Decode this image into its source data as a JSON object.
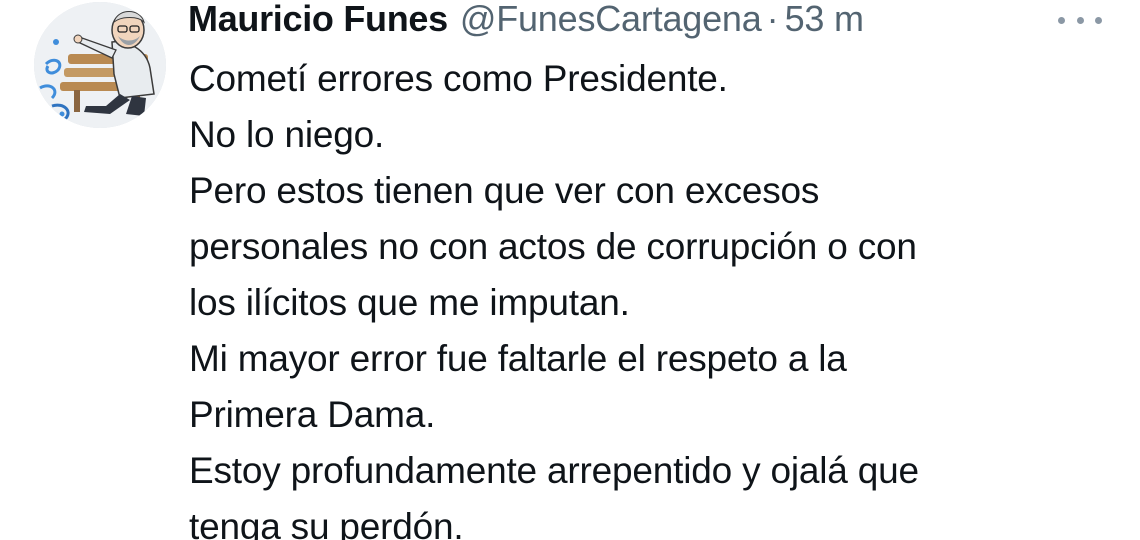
{
  "tweet": {
    "author_name": "Mauricio Funes",
    "author_handle": "@FunesCartagena",
    "separator": "·",
    "timestamp": "53 m",
    "avatar_icon": "cartoon-caricature-avatar",
    "more_icon": "more-horizontal-icon",
    "lines": [
      "Cometí errores como Presidente.",
      "No lo niego.",
      "Pero estos tienen que ver con excesos",
      "personales no con actos de corrupción o con",
      "los ilícitos que me imputan.",
      "Mi mayor error fue faltarle el respeto a la",
      "Primera Dama.",
      "Estoy profundamente arrepentido y ojalá que",
      "tenga su perdón."
    ]
  },
  "colors": {
    "text": "#0f1419",
    "secondary": "#536471",
    "icon": "#8b98a5",
    "background": "#ffffff"
  }
}
